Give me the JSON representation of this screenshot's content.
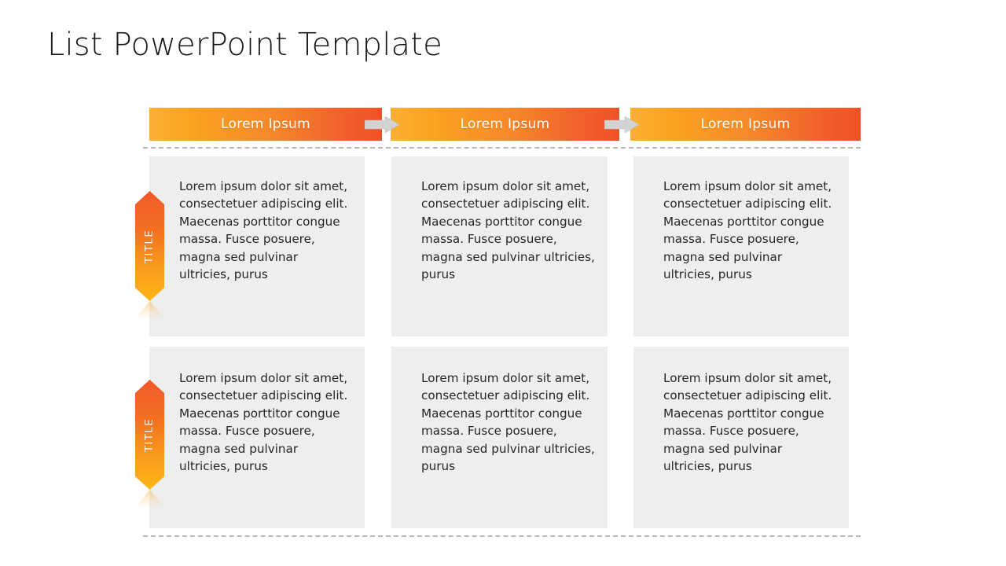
{
  "slide": {
    "title": "List PowerPoint Template",
    "background_color": "#ffffff"
  },
  "theme": {
    "gradient_start": "#fbb034",
    "gradient_end": "#ef5126",
    "box_background": "#eeeeee",
    "divider_color": "#b9b9b9",
    "arrow_color": "#d2d2d2",
    "header_text_color": "#ffffff",
    "body_text_color": "#262626"
  },
  "header": {
    "bars": [
      {
        "label": "Lorem Ipsum"
      },
      {
        "label": "Lorem Ipsum"
      },
      {
        "label": "Lorem Ipsum"
      }
    ],
    "arrows": [
      {
        "name": "flow-arrow-1"
      },
      {
        "name": "flow-arrow-2"
      }
    ]
  },
  "rows": [
    {
      "badge_label": "TITLE",
      "cells": [
        {
          "text": "Lorem ipsum dolor sit amet, consectetuer adipiscing elit. Maecenas porttitor congue massa. Fusce posuere, magna sed pulvinar ultricies, purus"
        },
        {
          "text": "Lorem ipsum dolor sit amet, consectetuer adipiscing elit. Maecenas porttitor congue massa. Fusce posuere, magna sed pulvinar ultricies, purus"
        },
        {
          "text": "Lorem ipsum dolor sit amet, consectetuer adipiscing elit. Maecenas porttitor congue massa. Fusce posuere, magna sed pulvinar ultricies, purus"
        }
      ]
    },
    {
      "badge_label": "TITLE",
      "cells": [
        {
          "text": "Lorem ipsum dolor sit amet, consectetuer adipiscing elit. Maecenas porttitor congue massa. Fusce posuere, magna sed pulvinar ultricies, purus"
        },
        {
          "text": "Lorem ipsum dolor sit amet, consectetuer adipiscing elit. Maecenas porttitor congue massa. Fusce posuere, magna sed pulvinar ultricies, purus"
        },
        {
          "text": "Lorem ipsum dolor sit amet, consectetuer adipiscing elit. Maecenas porttitor congue massa. Fusce posuere, magna sed pulvinar ultricies, purus"
        }
      ]
    }
  ]
}
